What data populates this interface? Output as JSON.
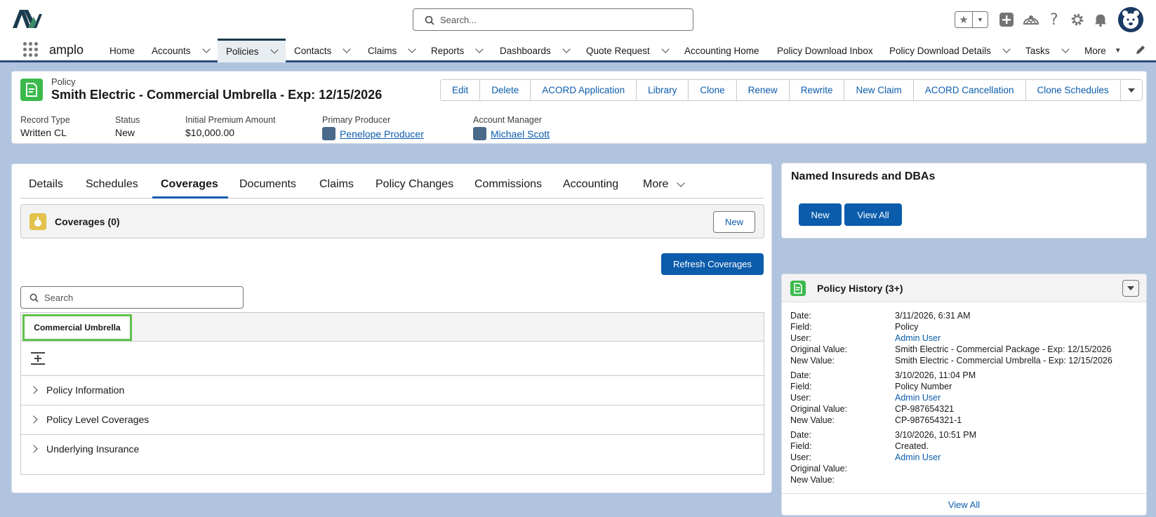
{
  "global": {
    "search_placeholder": "Search..."
  },
  "nav": {
    "app_name": "amplo",
    "items": [
      {
        "label": "Home",
        "dropdown": false
      },
      {
        "label": "Accounts",
        "dropdown": true
      },
      {
        "label": "Policies",
        "dropdown": true,
        "active": true
      },
      {
        "label": "Contacts",
        "dropdown": true
      },
      {
        "label": "Claims",
        "dropdown": true
      },
      {
        "label": "Reports",
        "dropdown": true
      },
      {
        "label": "Dashboards",
        "dropdown": true
      },
      {
        "label": "Quote Request",
        "dropdown": true
      },
      {
        "label": "Accounting Home",
        "dropdown": false
      },
      {
        "label": "Policy Download Inbox",
        "dropdown": false
      },
      {
        "label": "Policy Download Details",
        "dropdown": true
      },
      {
        "label": "Tasks",
        "dropdown": true
      },
      {
        "label": "More",
        "dropdown": true
      }
    ]
  },
  "header": {
    "object_label": "Policy",
    "title": "Smith Electric - Commercial Umbrella - Exp: 12/15/2026",
    "actions": [
      "Edit",
      "Delete",
      "ACORD Application",
      "Library",
      "Clone",
      "Renew",
      "Rewrite",
      "New Claim",
      "ACORD Cancellation",
      "Clone Schedules"
    ],
    "fields": [
      {
        "label": "Record Type",
        "value": "Written CL"
      },
      {
        "label": "Status",
        "value": "New"
      },
      {
        "label": "Initial Premium Amount",
        "value": "$10,000.00"
      },
      {
        "label": "Primary Producer",
        "value": "Penelope Producer"
      },
      {
        "label": "Account Manager",
        "value": "Michael Scott"
      }
    ]
  },
  "tabs": [
    "Details",
    "Schedules",
    "Coverages",
    "Documents",
    "Claims",
    "Policy Changes",
    "Commissions",
    "Accounting",
    "More"
  ],
  "active_tab": "Coverages",
  "coverages": {
    "title": "Coverages (0)",
    "new_label": "New",
    "refresh_label": "Refresh Coverages",
    "search_placeholder": "Search",
    "subtab": "Commercial Umbrella",
    "sections": [
      "Policy Information",
      "Policy Level Coverages",
      "Underlying Insurance"
    ]
  },
  "named_insureds": {
    "title": "Named Insureds and DBAs",
    "new_label": "New",
    "view_all_label": "View All"
  },
  "history": {
    "title": "Policy History (3+)",
    "labels": {
      "date": "Date:",
      "field": "Field:",
      "user": "User:",
      "original": "Original Value:",
      "new": "New Value:"
    },
    "entries": [
      {
        "date": "3/11/2026, 6:31 AM",
        "field": "Policy",
        "user": "Admin User",
        "original": "Smith Electric - Commercial Package - Exp: 12/15/2026",
        "new": "Smith Electric - Commercial Umbrella - Exp: 12/15/2026"
      },
      {
        "date": "3/10/2026, 11:04 PM",
        "field": "Policy Number",
        "user": "Admin User",
        "original": "CP-987654321",
        "new": "CP-987654321-1"
      },
      {
        "date": "3/10/2026, 10:51 PM",
        "field": "Created.",
        "user": "Admin User",
        "original": "",
        "new": ""
      }
    ],
    "view_all_label": "View All"
  },
  "colors": {
    "brand": "#0b5cab",
    "nav_active": "#1b3a4e",
    "record_icon": "#3bba4c",
    "coverage_icon": "#e3c24e",
    "subtab_highlight": "#5ec24c"
  }
}
